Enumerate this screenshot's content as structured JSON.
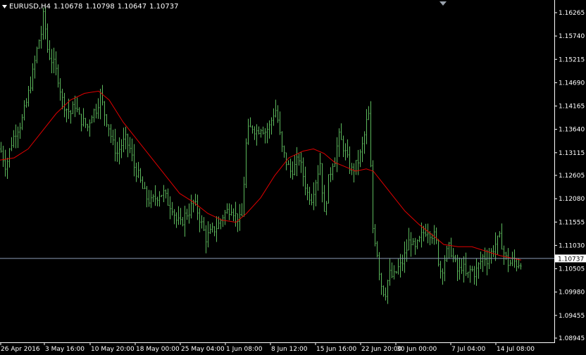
{
  "header": {
    "symbol": "EURUSD,H4",
    "open": "1.10678",
    "high": "1.10798",
    "low": "1.10647",
    "close": "1.10737"
  },
  "colors": {
    "background": "#000000",
    "bars": "#5cb85c",
    "ma": "#e00000",
    "axis": "#ffffff",
    "current_line": "#8a9bb5"
  },
  "chart_data": {
    "type": "ohlc",
    "symbol": "EURUSD",
    "timeframe": "H4",
    "ylim": [
      1.0885,
      1.1655
    ],
    "yticks": [
      "1.16265",
      "1.15740",
      "1.15215",
      "1.14690",
      "1.14165",
      "1.13640",
      "1.13115",
      "1.12605",
      "1.12080",
      "1.11555",
      "1.11030",
      "1.10505",
      "1.09980",
      "1.09455",
      "1.08945"
    ],
    "xticks": [
      "26 Apr 2016",
      "3 May 16:00",
      "10 May 20:00",
      "18 May 00:00",
      "25 May 04:00",
      "1 Jun 08:00",
      "8 Jun 12:00",
      "15 Jun 16:00",
      "22 Jun 20:00",
      "30 Jun 00:00",
      "7 Jul 04:00",
      "14 Jul 08:00"
    ],
    "current_price": "1.10737",
    "price_path": [
      [
        0,
        1.132
      ],
      [
        8,
        1.128
      ],
      [
        15,
        1.133
      ],
      [
        22,
        1.136
      ],
      [
        30,
        1.138
      ],
      [
        38,
        1.143
      ],
      [
        46,
        1.149
      ],
      [
        54,
        1.156
      ],
      [
        58,
        1.158
      ],
      [
        62,
        1.163
      ],
      [
        66,
        1.155
      ],
      [
        70,
        1.153
      ],
      [
        76,
        1.151
      ],
      [
        82,
        1.148
      ],
      [
        88,
        1.143
      ],
      [
        94,
        1.141
      ],
      [
        100,
        1.14
      ],
      [
        106,
        1.142
      ],
      [
        112,
        1.139
      ],
      [
        118,
        1.138
      ],
      [
        124,
        1.137
      ],
      [
        130,
        1.14
      ],
      [
        136,
        1.141
      ],
      [
        142,
        1.144
      ],
      [
        148,
        1.14
      ],
      [
        154,
        1.137
      ],
      [
        160,
        1.133
      ],
      [
        166,
        1.131
      ],
      [
        172,
        1.133
      ],
      [
        178,
        1.134
      ],
      [
        184,
        1.132
      ],
      [
        190,
        1.128
      ],
      [
        196,
        1.126
      ],
      [
        202,
        1.123
      ],
      [
        208,
        1.121
      ],
      [
        214,
        1.12
      ],
      [
        220,
        1.121
      ],
      [
        226,
        1.122
      ],
      [
        232,
        1.122
      ],
      [
        238,
        1.12
      ],
      [
        244,
        1.119
      ],
      [
        250,
        1.116
      ],
      [
        256,
        1.115
      ],
      [
        262,
        1.117
      ],
      [
        268,
        1.118
      ],
      [
        274,
        1.12
      ],
      [
        280,
        1.118
      ],
      [
        286,
        1.115
      ],
      [
        292,
        1.112
      ],
      [
        298,
        1.113
      ],
      [
        304,
        1.114
      ],
      [
        310,
        1.115
      ],
      [
        316,
        1.117
      ],
      [
        322,
        1.118
      ],
      [
        328,
        1.119
      ],
      [
        334,
        1.117
      ],
      [
        340,
        1.116
      ],
      [
        344,
        1.117
      ],
      [
        348,
        1.132
      ],
      [
        352,
        1.136
      ],
      [
        358,
        1.137
      ],
      [
        364,
        1.136
      ],
      [
        370,
        1.137
      ],
      [
        376,
        1.136
      ],
      [
        382,
        1.137
      ],
      [
        388,
        1.14
      ],
      [
        392,
        1.141
      ],
      [
        396,
        1.136
      ],
      [
        400,
        1.132
      ],
      [
        406,
        1.129
      ],
      [
        412,
        1.127
      ],
      [
        418,
        1.128
      ],
      [
        424,
        1.13
      ],
      [
        430,
        1.126
      ],
      [
        436,
        1.122
      ],
      [
        442,
        1.121
      ],
      [
        448,
        1.125
      ],
      [
        454,
        1.129
      ],
      [
        460,
        1.117
      ],
      [
        466,
        1.125
      ],
      [
        472,
        1.129
      ],
      [
        476,
        1.13
      ],
      [
        480,
        1.135
      ],
      [
        486,
        1.133
      ],
      [
        492,
        1.13
      ],
      [
        498,
        1.127
      ],
      [
        504,
        1.128
      ],
      [
        510,
        1.13
      ],
      [
        516,
        1.134
      ],
      [
        520,
        1.138
      ],
      [
        524,
        1.14
      ],
      [
        528,
        1.115
      ],
      [
        534,
        1.11
      ],
      [
        540,
        1.102
      ],
      [
        546,
        1.099
      ],
      [
        552,
        1.104
      ],
      [
        558,
        1.103
      ],
      [
        564,
        1.105
      ],
      [
        570,
        1.106
      ],
      [
        576,
        1.109
      ],
      [
        582,
        1.112
      ],
      [
        588,
        1.109
      ],
      [
        594,
        1.111
      ],
      [
        600,
        1.113
      ],
      [
        606,
        1.114
      ],
      [
        612,
        1.113
      ],
      [
        618,
        1.112
      ],
      [
        622,
        1.107
      ],
      [
        626,
        1.104
      ],
      [
        632,
        1.108
      ],
      [
        638,
        1.11
      ],
      [
        644,
        1.107
      ],
      [
        650,
        1.104
      ],
      [
        656,
        1.106
      ],
      [
        662,
        1.103
      ],
      [
        668,
        1.105
      ],
      [
        674,
        1.104
      ],
      [
        680,
        1.106
      ],
      [
        686,
        1.108
      ],
      [
        692,
        1.107
      ],
      [
        698,
        1.109
      ],
      [
        704,
        1.111
      ],
      [
        710,
        1.112
      ],
      [
        716,
        1.108
      ],
      [
        722,
        1.106
      ],
      [
        728,
        1.107
      ],
      [
        734,
        1.106
      ],
      [
        740,
        1.107
      ]
    ],
    "ma_path": [
      [
        0,
        1.1295
      ],
      [
        20,
        1.13
      ],
      [
        40,
        1.132
      ],
      [
        60,
        1.136
      ],
      [
        80,
        1.14
      ],
      [
        100,
        1.143
      ],
      [
        120,
        1.1445
      ],
      [
        140,
        1.145
      ],
      [
        155,
        1.143
      ],
      [
        175,
        1.138
      ],
      [
        195,
        1.134
      ],
      [
        215,
        1.13
      ],
      [
        235,
        1.126
      ],
      [
        255,
        1.122
      ],
      [
        275,
        1.12
      ],
      [
        295,
        1.1175
      ],
      [
        315,
        1.116
      ],
      [
        335,
        1.1155
      ],
      [
        350,
        1.1175
      ],
      [
        370,
        1.121
      ],
      [
        390,
        1.126
      ],
      [
        410,
        1.13
      ],
      [
        430,
        1.1315
      ],
      [
        445,
        1.132
      ],
      [
        460,
        1.131
      ],
      [
        475,
        1.129
      ],
      [
        490,
        1.128
      ],
      [
        505,
        1.127
      ],
      [
        520,
        1.1275
      ],
      [
        530,
        1.127
      ],
      [
        545,
        1.124
      ],
      [
        560,
        1.121
      ],
      [
        575,
        1.118
      ],
      [
        595,
        1.115
      ],
      [
        615,
        1.1125
      ],
      [
        630,
        1.1105
      ],
      [
        650,
        1.11
      ],
      [
        670,
        1.11
      ],
      [
        690,
        1.109
      ],
      [
        710,
        1.108
      ],
      [
        725,
        1.1075
      ],
      [
        740,
        1.107
      ]
    ]
  }
}
